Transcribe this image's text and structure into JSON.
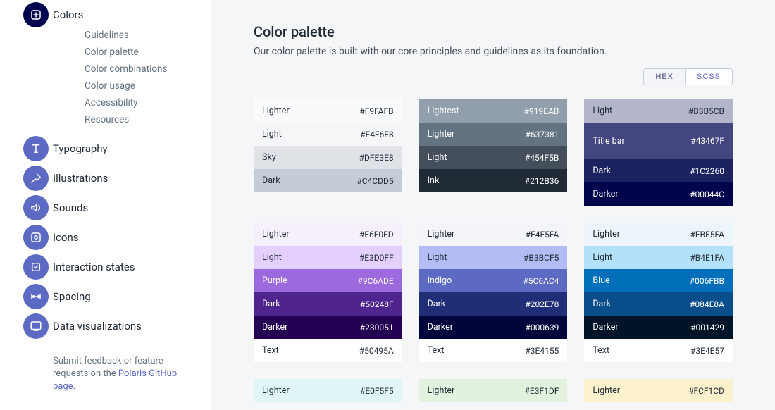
{
  "sidebar": {
    "sections": [
      {
        "id": "colors",
        "label": "Colors",
        "active": true,
        "children": [
          {
            "label": "Guidelines"
          },
          {
            "label": "Color palette"
          },
          {
            "label": "Color combinations"
          },
          {
            "label": "Color usage"
          },
          {
            "label": "Accessibility"
          },
          {
            "label": "Resources"
          }
        ]
      },
      {
        "id": "typography",
        "label": "Typography"
      },
      {
        "id": "illustrations",
        "label": "Illustrations"
      },
      {
        "id": "sounds",
        "label": "Sounds"
      },
      {
        "id": "icons",
        "label": "Icons"
      },
      {
        "id": "interaction",
        "label": "Interaction states"
      },
      {
        "id": "spacing",
        "label": "Spacing"
      },
      {
        "id": "dataviz",
        "label": "Data visualizations"
      }
    ],
    "footer": {
      "text_before": "Submit feedback or feature requests on the ",
      "link_label": "Polaris GitHub page",
      "text_after": "."
    }
  },
  "main": {
    "title": "Color palette",
    "description": "Our color palette is built with our core principles and guidelines as its foundation.",
    "toggle": {
      "hex": "HEX",
      "scss": "SCSS",
      "active": "hex"
    },
    "groups": [
      [
        {
          "name": "Lighter",
          "value": "#F9FAFB",
          "bg": "#F9FAFB",
          "text": "dark"
        },
        {
          "name": "Light",
          "value": "#F4F6F8",
          "bg": "#F4F6F8",
          "text": "dark"
        },
        {
          "name": "Sky",
          "value": "#DFE3E8",
          "bg": "#DFE3E8",
          "text": "dark"
        },
        {
          "name": "Dark",
          "value": "#C4CDD5",
          "bg": "#C4CDD5",
          "text": "dark"
        }
      ],
      [
        {
          "name": "Lightest",
          "value": "#919EAB",
          "bg": "#919EAB",
          "text": "light"
        },
        {
          "name": "Lighter",
          "value": "#637381",
          "bg": "#637381",
          "text": "light"
        },
        {
          "name": "Light",
          "value": "#454F5B",
          "bg": "#454F5B",
          "text": "light"
        },
        {
          "name": "Ink",
          "value": "#212B36",
          "bg": "#212B36",
          "text": "light"
        }
      ],
      [
        {
          "name": "Light",
          "value": "#B3B5CB",
          "bg": "#B3B5CB",
          "text": "dark"
        },
        {
          "name": "Title bar",
          "value": "#43467F",
          "bg": "#43467F",
          "text": "light",
          "tall": true
        },
        {
          "name": "Dark",
          "value": "#1C2260",
          "bg": "#1C2260",
          "text": "light"
        },
        {
          "name": "Darker",
          "value": "#00044C",
          "bg": "#00044C",
          "text": "light"
        }
      ],
      [
        {
          "name": "Lighter",
          "value": "#F6F0FD",
          "bg": "#F6F0FD",
          "text": "dark"
        },
        {
          "name": "Light",
          "value": "#E3D0FF",
          "bg": "#E3D0FF",
          "text": "dark"
        },
        {
          "name": "Purple",
          "value": "#9C6ADE",
          "bg": "#9C6ADE",
          "text": "light"
        },
        {
          "name": "Dark",
          "value": "#50248F",
          "bg": "#50248F",
          "text": "light"
        },
        {
          "name": "Darker",
          "value": "#230051",
          "bg": "#230051",
          "text": "light"
        },
        {
          "name": "Text",
          "value": "#50495A",
          "bg": "#FFFFFF",
          "text": "dark"
        }
      ],
      [
        {
          "name": "Lighter",
          "value": "#F4F5FA",
          "bg": "#F4F5FA",
          "text": "dark"
        },
        {
          "name": "Light",
          "value": "#B3BCF5",
          "bg": "#B3BCF5",
          "text": "dark"
        },
        {
          "name": "Indigo",
          "value": "#5C6AC4",
          "bg": "#5C6AC4",
          "text": "light"
        },
        {
          "name": "Dark",
          "value": "#202E78",
          "bg": "#202E78",
          "text": "light"
        },
        {
          "name": "Darker",
          "value": "#000639",
          "bg": "#000639",
          "text": "light"
        },
        {
          "name": "Text",
          "value": "#3E4155",
          "bg": "#FFFFFF",
          "text": "dark"
        }
      ],
      [
        {
          "name": "Lighter",
          "value": "#EBF5FA",
          "bg": "#EBF5FA",
          "text": "dark"
        },
        {
          "name": "Light",
          "value": "#B4E1FA",
          "bg": "#B4E1FA",
          "text": "dark"
        },
        {
          "name": "Blue",
          "value": "#006FBB",
          "bg": "#006FBB",
          "text": "light"
        },
        {
          "name": "Dark",
          "value": "#084E8A",
          "bg": "#084E8A",
          "text": "light"
        },
        {
          "name": "Darker",
          "value": "#001429",
          "bg": "#001429",
          "text": "light"
        },
        {
          "name": "Text",
          "value": "#3E4E57",
          "bg": "#FFFFFF",
          "text": "dark"
        }
      ],
      [
        {
          "name": "Lighter",
          "value": "#E0F5F5",
          "bg": "#E0F5F5",
          "text": "dark"
        }
      ],
      [
        {
          "name": "Lighter",
          "value": "#E3F1DF",
          "bg": "#E3F1DF",
          "text": "dark"
        }
      ],
      [
        {
          "name": "Lighter",
          "value": "#FCF1CD",
          "bg": "#FCF1CD",
          "text": "dark"
        }
      ]
    ]
  }
}
